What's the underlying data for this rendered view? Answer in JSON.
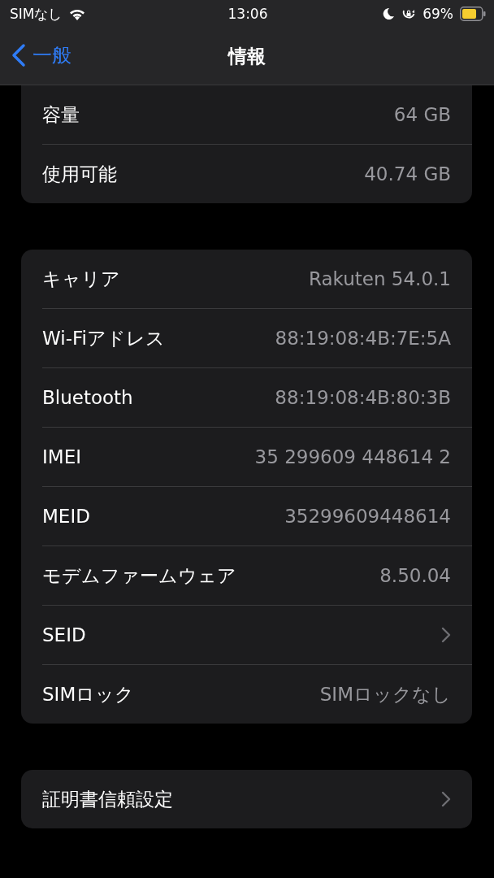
{
  "status_bar": {
    "carrier": "SIMなし",
    "time": "13:06",
    "battery_percent": "69%"
  },
  "nav_bar": {
    "back_label": "一般",
    "title": "情報"
  },
  "groups": [
    {
      "cut_top": true,
      "rows": [
        {
          "kind": "value",
          "label": "容量",
          "value": "64 GB"
        },
        {
          "kind": "value",
          "label": "使用可能",
          "value": "40.74 GB"
        }
      ]
    },
    {
      "cut_top": false,
      "rows": [
        {
          "kind": "value",
          "label": "キャリア",
          "value": "Rakuten 54.0.1"
        },
        {
          "kind": "value",
          "label": "Wi-Fiアドレス",
          "value": "88:19:08:4B:7E:5A"
        },
        {
          "kind": "value",
          "label": "Bluetooth",
          "value": "88:19:08:4B:80:3B"
        },
        {
          "kind": "value",
          "label": "IMEI",
          "value": "35 299609 448614 2"
        },
        {
          "kind": "value",
          "label": "MEID",
          "value": "35299609448614"
        },
        {
          "kind": "value",
          "label": "モデムファームウェア",
          "value": "8.50.04"
        },
        {
          "kind": "link",
          "label": "SEID"
        },
        {
          "kind": "value",
          "label": "SIMロック",
          "value": "SIMロックなし"
        }
      ]
    },
    {
      "cut_top": false,
      "rows": [
        {
          "kind": "link",
          "label": "証明書信頼設定"
        }
      ]
    }
  ]
}
